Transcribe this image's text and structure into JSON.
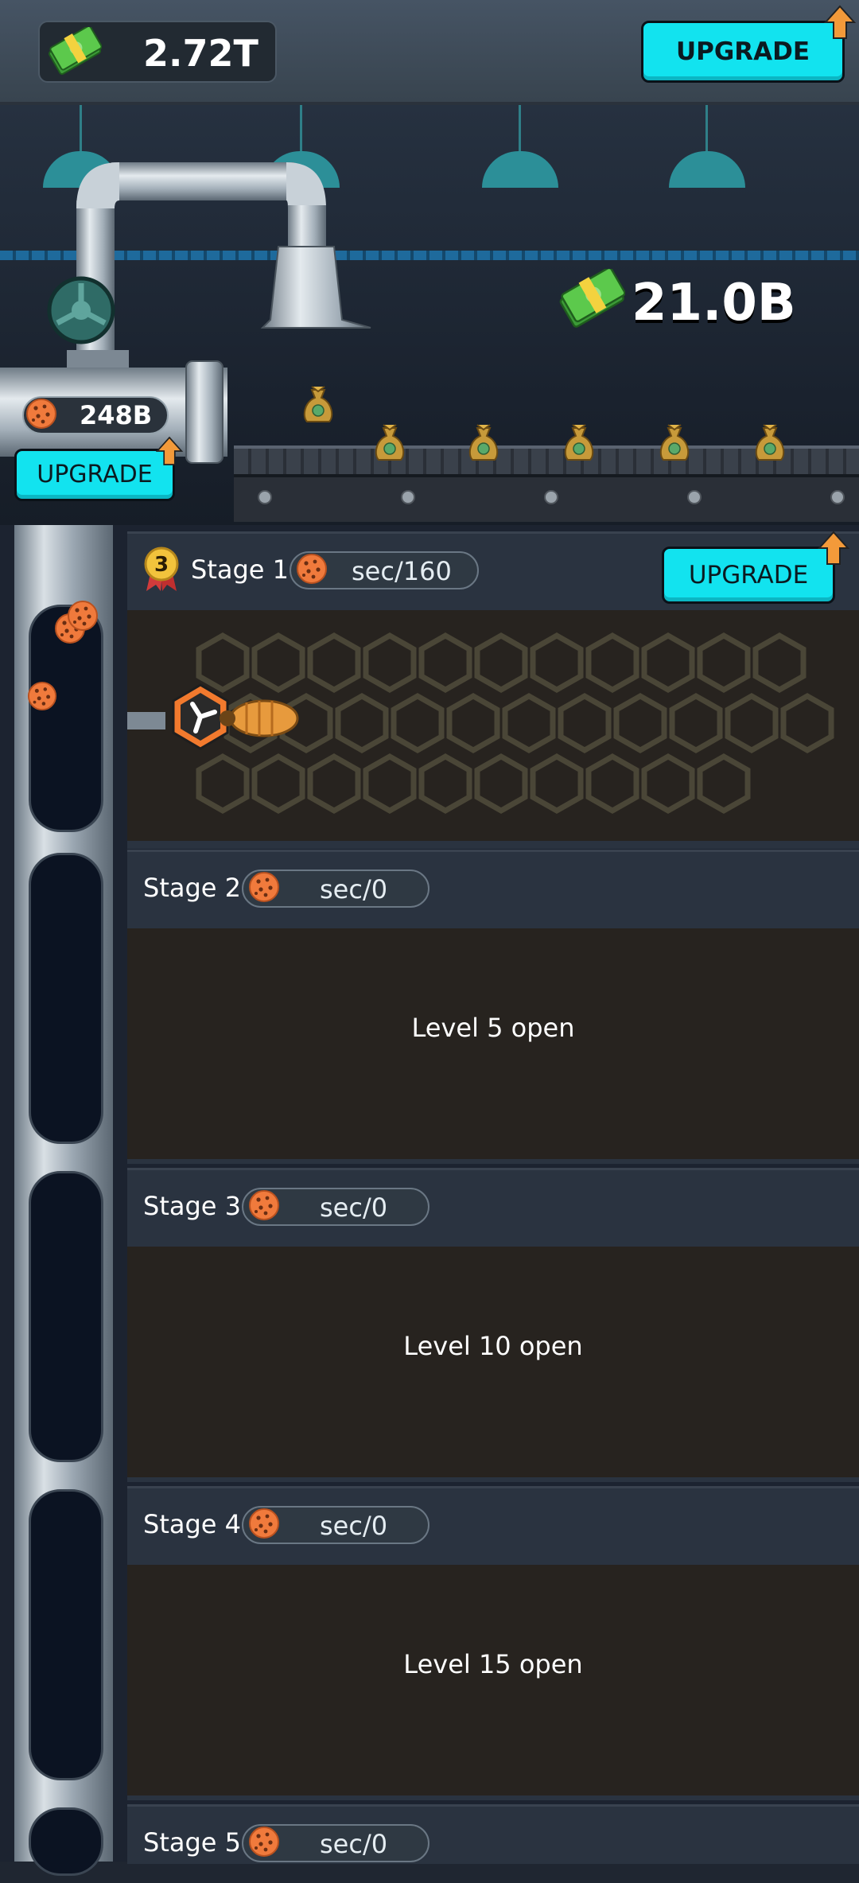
{
  "header": {
    "money": "2.72T",
    "upgrade_label": "UPGRADE"
  },
  "factory": {
    "income": "21.0B",
    "bulk_amount": "248B",
    "upgrade_label": "UPGRADE"
  },
  "stages": [
    {
      "title": "Stage 1",
      "rate": "sec/160",
      "level_badge": "3",
      "upgrade_label": "UPGRADE"
    },
    {
      "title": "Stage 2",
      "rate": "sec/0",
      "locked": "Level 5 open"
    },
    {
      "title": "Stage 3",
      "rate": "sec/0",
      "locked": "Level 10 open"
    },
    {
      "title": "Stage 4",
      "rate": "sec/0",
      "locked": "Level 15 open"
    },
    {
      "title": "Stage 5",
      "rate": "sec/0"
    }
  ],
  "colors": {
    "accent_button": "#12e3ef",
    "arrow": "#f39a3a",
    "cookie": "#f07a3c"
  },
  "icons": [
    "cash-icon",
    "upgrade-arrow-icon",
    "cookie-icon",
    "money-bag-icon",
    "valve-icon",
    "fan-icon",
    "beetle-icon",
    "level-medal-icon"
  ]
}
